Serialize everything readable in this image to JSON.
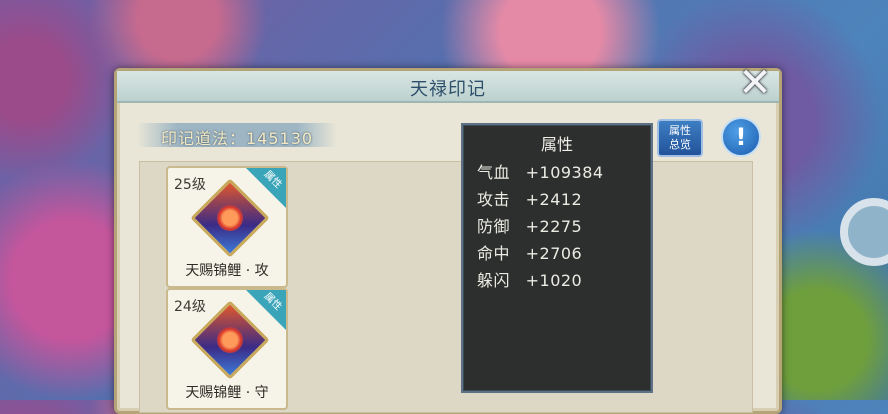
{
  "dialog": {
    "title": "天禄印记",
    "score_label": "印记道法：145130"
  },
  "buttons": {
    "attr_overview_line1": "属性",
    "attr_overview_line2": "总览",
    "info": "!",
    "close": "✕"
  },
  "cards": [
    {
      "level": "25级",
      "badge": "属性",
      "name": "天赐锦鲤 · 攻"
    },
    {
      "level": "24级",
      "badge": "属性",
      "name": "天赐锦鲤 · 守"
    }
  ],
  "attributes_popup": {
    "title": "属性",
    "rows": [
      {
        "label": "气血",
        "value": "+109384"
      },
      {
        "label": "攻击",
        "value": "+2412"
      },
      {
        "label": "防御",
        "value": "+2275"
      },
      {
        "label": "命中",
        "value": "+2706"
      },
      {
        "label": "躲闪",
        "value": "+1020"
      }
    ]
  },
  "colors": {
    "panel_bg": "#e9e6d7",
    "title_color": "#2e4f6b",
    "popup_bg": "#2d2f2e",
    "badge": "#3aa4b8",
    "button_blue": "#22539b"
  }
}
